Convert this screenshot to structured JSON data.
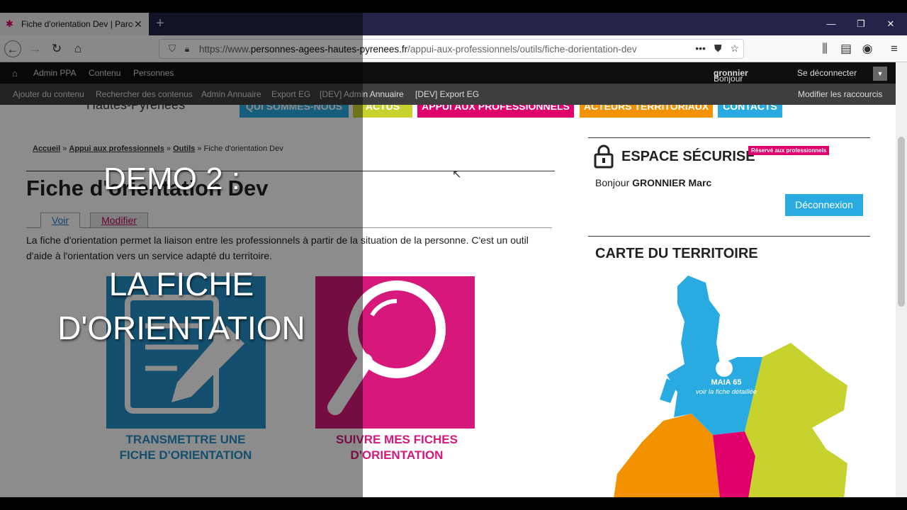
{
  "browser": {
    "tab_title": "Fiche d'orientation Dev | Parco",
    "new_tab": "+",
    "url_host_prefix": "https://www.",
    "url_host": "personnes-agees-hautes-pyrenees.fr",
    "url_path": "/appui-aux-professionnels/outils/fiche-dorientation-dev"
  },
  "admin_toolbar": {
    "row1": [
      "Admin PPA",
      "Contenu",
      "Personnes"
    ],
    "greeting": "Bonjour",
    "username": "gronnier",
    "logout": "Se déconnecter",
    "row2": [
      "Ajouter du contenu",
      "Rechercher des contenus",
      "Admin Annuaire",
      "Export EG",
      "[DEV] Admin Annuaire",
      "[DEV] Export EG"
    ],
    "shortcuts": "Modifier les raccourcis"
  },
  "site": {
    "name": "Hautes-Pyrénées",
    "menu": [
      {
        "label": "QUI SOMMES-NOUS",
        "color": "#29abe2"
      },
      {
        "label": "ACTUS",
        "color": "#c8d22e"
      },
      {
        "label": "APPUI AUX PROFESSIONNELS",
        "color": "#e0006c"
      },
      {
        "label": "ACTEURS TERRITORIAUX",
        "color": "#f39200"
      },
      {
        "label": "CONTACTS",
        "color": "#29abe2"
      }
    ]
  },
  "breadcrumb": {
    "items": [
      "Accueil",
      "Appui aux professionnels",
      "Outils"
    ],
    "current": "Fiche d'orientation Dev",
    "sep": "»"
  },
  "main": {
    "title": "Fiche d'orientation Dev",
    "tab_view": "Voir",
    "tab_edit": "Modifier",
    "intro": "La fiche d'orientation permet la liaison entre les professionnels à partir de la situation de la personne. C'est un outil d'aide à l'orientation vers un service adapté du territoire.",
    "card1_line1": "TRANSMETTRE UNE",
    "card1_line2": "FICHE D'ORIENTATION",
    "card2_line1": "SUIVRE MES FICHES",
    "card2_line2": "D'ORIENTATION"
  },
  "sidebar": {
    "secure_title": "ESPACE SÉCURISÉ",
    "secure_badge": "Réservé aux professionnels",
    "hello": "Bonjour",
    "user_name": "GRONNIER Marc",
    "logout_button": "Déconnexion",
    "map_title": "CARTE DU TERRITOIRE",
    "map_label": "MAIA 65",
    "map_sublabel": "voir la fiche détaillée"
  },
  "overlay": {
    "line1": "DEMO 2 :",
    "line2": "LA FICHE",
    "line3": "D'ORIENTATION"
  }
}
